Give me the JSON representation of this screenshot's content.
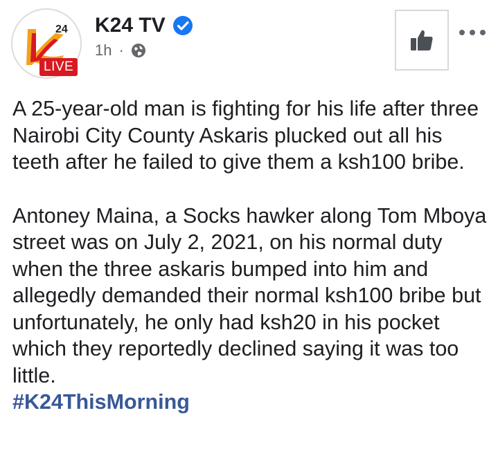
{
  "post": {
    "page_name": "K24 TV",
    "time": "1h",
    "separator": "·",
    "logo": {
      "number": "24",
      "badge": "LIVE"
    },
    "paragraph1": "A 25-year-old man is fighting for his life after three Nairobi City County Askaris plucked out all his teeth after he failed to give them a ksh100 bribe.",
    "paragraph2": "Antoney Maina, a Socks hawker along Tom Mboya street was on July 2, 2021, on his normal duty when the three askaris bumped into him and allegedly demanded their normal ksh100 bribe but unfortunately, he only had ksh20 in his pocket which they reportedly declined saying it was too little.",
    "hashtag": "#K24ThisMorning"
  },
  "icons": {
    "verified": "verified-badge-icon",
    "audience": "globe-icon",
    "like": "thumbs-up-icon",
    "more": "more-options-icon"
  },
  "colors": {
    "brand_red": "#d71a21",
    "verified_blue": "#1877f2",
    "hashtag_blue": "#385898",
    "meta_gray": "#65676b"
  }
}
